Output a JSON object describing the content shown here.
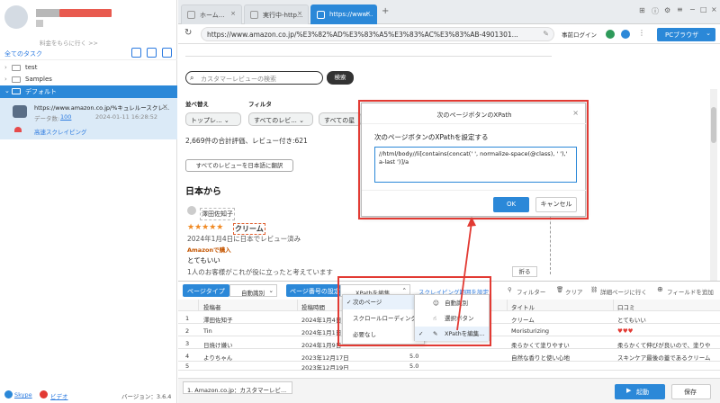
{
  "sidebar": {
    "premium_link": "料金をもらに行く >>",
    "tasks_title": "全てのタスク",
    "folders": [
      "test",
      "Samples",
      "デフォルト"
    ],
    "task": {
      "url": "https://www.amazon.co.jp/%キュレルースクレ...",
      "count_label": "データ数:",
      "count": "100",
      "date": "2024-01-11 16:28:52",
      "speed_label": "高速スクレイピング"
    },
    "footer": {
      "skype": "Skype",
      "video": "ビデオ",
      "version": "バージョン：3.6.4"
    }
  },
  "tabs": [
    {
      "label": "ホーム..."
    },
    {
      "label": "実行中-http..."
    },
    {
      "label": "https://www..."
    }
  ],
  "urlbar": {
    "url": "https://www.amazon.co.jp/%E3%82%AD%E3%83%A5%E3%83%AC%E3%83%AB-4901301...",
    "pre_login": "事前ログイン",
    "pc_browser": "PCブラウザ"
  },
  "page": {
    "search_placeholder": "カスタマーレビューの検索",
    "search_button": "検索",
    "sort_label": "並べ替え",
    "filter_label": "フィルタ",
    "sort_value": "トップレ...",
    "filter_value": "すべてのレビ...",
    "filter2_value": "すべての星",
    "review_count": "2,669件の合計評価、レビュー付き:621",
    "translate_button": "すべてのレビューを日本語に翻訳",
    "section_title": "日本から",
    "reviewer": "澤田佐知子",
    "stars": "★★★★★",
    "review_title": "クリーム",
    "review_date": "2024年1月4日に日本でレビュー済み",
    "purchase_badge": "Amazonで購入",
    "review_body": "とてもいい",
    "helpful": "1人のお客様がこれが役に立ったと考えています",
    "fold_button": "折る"
  },
  "toolbar": {
    "page_type_label": "ページタイプ",
    "page_type_value": "自動識別",
    "page_num_label": "ページ番号の設定",
    "page_num_value": "XPathを編集",
    "scrape_range": "スクレイピング範囲を設定",
    "filter": "フィルター",
    "clear": "クリア",
    "detail": "詳細ページに行く",
    "add_field": "フィールドを追加"
  },
  "grid": {
    "headers": [
      "",
      "投稿者",
      "投稿時間",
      "",
      "タイトル",
      "口コミ"
    ],
    "rows": [
      [
        "1",
        "澤田佐知子",
        "2024年1月4日",
        "",
        "クリーム",
        "とてもいい"
      ],
      [
        "2",
        "Tin",
        "2024年1月1日",
        "",
        "Moristurizing",
        "♥♥♥"
      ],
      [
        "3",
        "日焼け嫌い",
        "2024年1月9日",
        "4.0",
        "柔らかくて塗りやすい",
        "柔らかくて伸びが良いので、塗りや"
      ],
      [
        "4",
        "よりちゃん",
        "2023年12月17日",
        "5.0",
        "自然な香りと使い心地",
        "スキンケア最後の蓋であるクリーム"
      ],
      [
        "5",
        "",
        "2023年12月19日",
        "5.0",
        "",
        ""
      ]
    ]
  },
  "menu": {
    "level1": [
      "次のページ",
      "スクロールローディング",
      "必要なし"
    ],
    "level2": [
      "自動識別",
      "選択ボタン",
      "XPathを編集..."
    ]
  },
  "modal": {
    "title": "次のページボタンのXPath",
    "subtitle": "次のページボタンのXPathを設定する",
    "xpath": "//html/body//li[contains(concat(' ', normalize-space(@class), ' '),' a-last ')]/a",
    "ok": "OK",
    "cancel": "キャンセル"
  },
  "footer": {
    "tab": "1. Amazon.co.jp：カスタマーレビ...",
    "start": "起動",
    "save": "保存"
  },
  "colors": {
    "accent": "#2b88d8",
    "highlight": "#e23a33"
  }
}
